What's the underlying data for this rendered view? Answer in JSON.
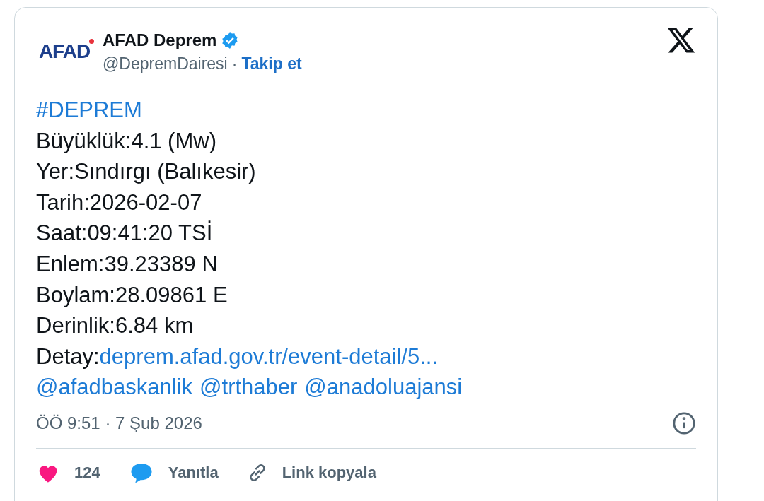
{
  "author": {
    "logo_text": "AFAD",
    "name": "AFAD Deprem",
    "verified": true,
    "handle": "@DepremDairesi",
    "separator": "·",
    "follow": "Takip et"
  },
  "body": [
    [
      {
        "kind": "link",
        "text": "#DEPREM"
      }
    ],
    [
      {
        "kind": "plain",
        "text": "Büyüklük:4.1 (Mw)"
      }
    ],
    [
      {
        "kind": "plain",
        "text": "Yer:Sındırgı (Balıkesir)"
      }
    ],
    [
      {
        "kind": "plain",
        "text": "Tarih:2026-02-07"
      }
    ],
    [
      {
        "kind": "plain",
        "text": "Saat:09:41:20 TSİ"
      }
    ],
    [
      {
        "kind": "plain",
        "text": "Enlem:39.23389 N"
      }
    ],
    [
      {
        "kind": "plain",
        "text": "Boylam:28.09861 E"
      }
    ],
    [
      {
        "kind": "plain",
        "text": "Derinlik:6.84 km"
      }
    ],
    [
      {
        "kind": "plain",
        "text": "Detay:"
      },
      {
        "kind": "link",
        "text": "deprem.afad.gov.tr/event-detail/5..."
      }
    ],
    [
      {
        "kind": "link",
        "text": "@afadbaskanlik"
      },
      {
        "kind": "link",
        "text": "@trthaber"
      },
      {
        "kind": "link",
        "text": "@anadoluajansi"
      }
    ]
  ],
  "timestamp": "ÖÖ 9:51 · 7 Şub 2026",
  "actions": [
    {
      "kind": "like",
      "label": "124"
    },
    {
      "kind": "reply",
      "label": "Yanıtla"
    },
    {
      "kind": "copy",
      "label": "Link kopyala"
    }
  ]
}
